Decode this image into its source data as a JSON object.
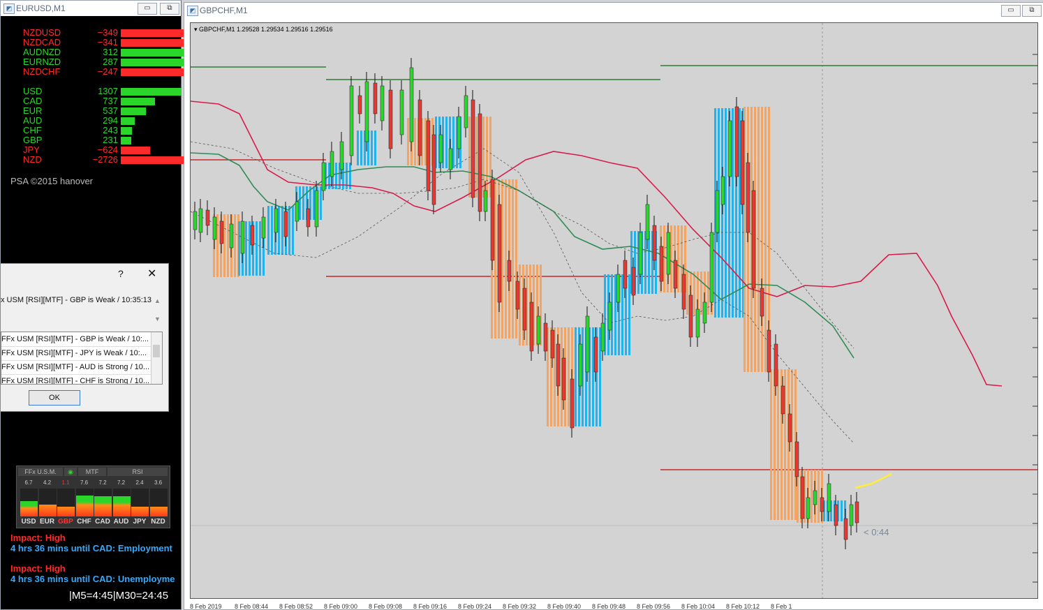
{
  "left_window": {
    "title": "EURUSD,M1"
  },
  "psa": {
    "pairs": [
      {
        "sym": "NZDUSD",
        "val": "−349",
        "color": "#ff2a2a"
      },
      {
        "sym": "NZDCAD",
        "val": "−341",
        "color": "#ff2a2a"
      },
      {
        "sym": "AUDNZD",
        "val": "312",
        "color": "#2bd62b"
      },
      {
        "sym": "EURNZD",
        "val": "287",
        "color": "#2bd62b"
      },
      {
        "sym": "NZDCHF",
        "val": "−247",
        "color": "#ff2a2a"
      }
    ],
    "currencies": [
      {
        "sym": "USD",
        "val": "1307",
        "color": "#2bd62b"
      },
      {
        "sym": "CAD",
        "val": "737",
        "color": "#2bd62b"
      },
      {
        "sym": "EUR",
        "val": "537",
        "color": "#2bd62b"
      },
      {
        "sym": "AUD",
        "val": "294",
        "color": "#2bd62b"
      },
      {
        "sym": "CHF",
        "val": "243",
        "color": "#2bd62b"
      },
      {
        "sym": "GBP",
        "val": "231",
        "color": "#2bd62b"
      },
      {
        "sym": "JPY",
        "val": "−624",
        "color": "#ff2a2a"
      },
      {
        "sym": "NZD",
        "val": "−2726",
        "color": "#ff2a2a"
      }
    ],
    "copyright": "PSA ©2015 hanover"
  },
  "alert": {
    "help": "?",
    "close": "✕",
    "message": "x USM [RSI][MTF] - GBP is Weak / 10:35:13",
    "items": [
      "FFx USM [RSI][MTF] - GBP is Weak / 10:...",
      "FFx USM [RSI][MTF] - JPY is Weak / 10:...",
      "FFx USM [RSI][MTF] - AUD is Strong / 10...",
      "FFx USM [RSI][MTF] - CHF is Strong / 10..."
    ],
    "ok_label": "OK"
  },
  "meter": {
    "headers": [
      "FFx U.S.M.",
      "MTF",
      "RSI"
    ],
    "values": [
      "6.7",
      "4.2",
      "1.1",
      "7.6",
      "7.2",
      "7.2",
      "2.4",
      "3.6"
    ],
    "labels": [
      "USD",
      "EUR",
      "GBP",
      "CHF",
      "CAD",
      "AUD",
      "JPY",
      "NZD"
    ],
    "levels": [
      0.55,
      0.42,
      0.11,
      0.76,
      0.72,
      0.72,
      0.24,
      0.36
    ],
    "highlight": "GBP"
  },
  "news": [
    {
      "impact": "Impact: High",
      "text": "4 hrs 36 mins until CAD: Employment"
    },
    {
      "impact": "Impact: High",
      "text": "4 hrs 36 mins until CAD: Unemployme"
    }
  ],
  "timer": "|M5=4:45|M30=24:45",
  "chart_window": {
    "title": "GBPCHF,M1",
    "info": "▾ GBPCHF,M1  1.29528 1.29534 1.29516 1.29516",
    "countdown": "< 0:44",
    "time_labels": [
      "8 Feb 2019",
      "8 Feb 08:44",
      "8 Feb 08:52",
      "8 Feb 09:00",
      "8 Feb 09:08",
      "8 Feb 09:16",
      "8 Feb 09:24",
      "8 Feb 09:32",
      "8 Feb 09:40",
      "8 Feb 09:48",
      "8 Feb 09:56",
      "8 Feb 10:04",
      "8 Feb 10:12",
      "8 Feb 1"
    ]
  }
}
